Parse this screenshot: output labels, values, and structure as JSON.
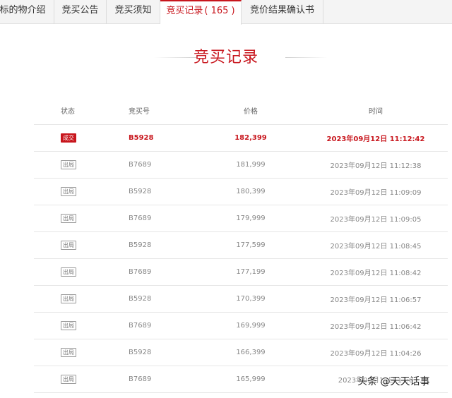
{
  "tabs": [
    {
      "label": "标的物介绍"
    },
    {
      "label": "竞买公告"
    },
    {
      "label": "竞买须知"
    },
    {
      "label": "竞买记录",
      "count": "( 165 )"
    },
    {
      "label": "竞价结果确认书"
    }
  ],
  "section_title": "竞买记录",
  "table": {
    "headers": [
      "状态",
      "竞买号",
      "价格",
      "时间"
    ],
    "rows": [
      {
        "status": "成交",
        "bidder": "B5928",
        "price": "182,399",
        "time": "2023年09月12日 11:12:42"
      },
      {
        "status": "出局",
        "bidder": "B7689",
        "price": "181,999",
        "time": "2023年09月12日 11:12:38"
      },
      {
        "status": "出局",
        "bidder": "B5928",
        "price": "180,399",
        "time": "2023年09月12日 11:09:09"
      },
      {
        "status": "出局",
        "bidder": "B7689",
        "price": "179,999",
        "time": "2023年09月12日 11:09:05"
      },
      {
        "status": "出局",
        "bidder": "B5928",
        "price": "177,599",
        "time": "2023年09月12日 11:08:45"
      },
      {
        "status": "出局",
        "bidder": "B7689",
        "price": "177,199",
        "time": "2023年09月12日 11:08:42"
      },
      {
        "status": "出局",
        "bidder": "B5928",
        "price": "170,399",
        "time": "2023年09月12日 11:06:57"
      },
      {
        "status": "出局",
        "bidder": "B7689",
        "price": "169,999",
        "time": "2023年09月12日 11:06:42"
      },
      {
        "status": "出局",
        "bidder": "B5928",
        "price": "166,399",
        "time": "2023年09月12日 11:04:26"
      },
      {
        "status": "出局",
        "bidder": "B7689",
        "price": "165,999",
        "time": "2023年09月12日 11:0"
      }
    ]
  },
  "watermark": "头条 @天天话事",
  "colors": {
    "accent": "#c8161d",
    "winner_badge_bg": "#c8161d"
  }
}
